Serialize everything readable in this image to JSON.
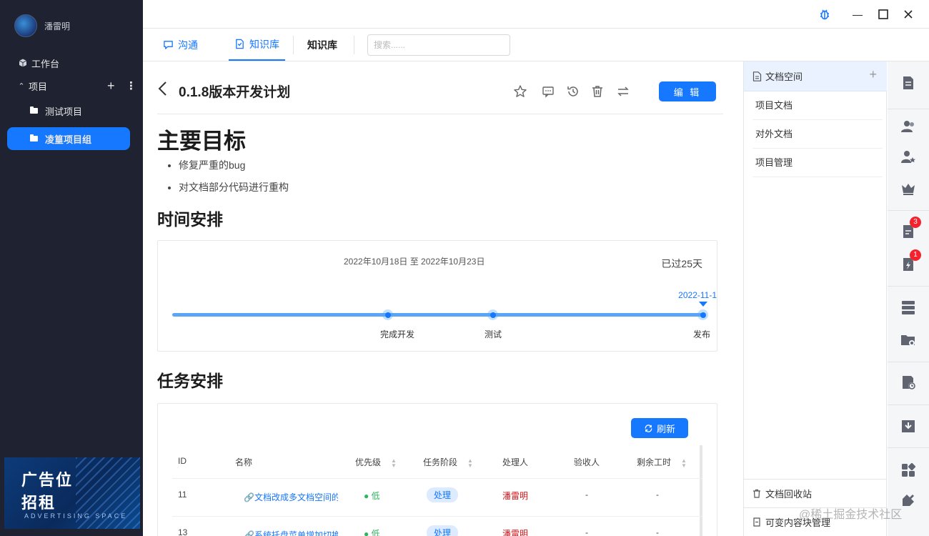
{
  "user": {
    "name": "潘雷明"
  },
  "sidebar": {
    "items": [
      {
        "label": "工作台"
      },
      {
        "label": "项目"
      },
      {
        "label": "测试项目"
      },
      {
        "label": "凌篁项目组"
      }
    ],
    "ad": {
      "line1": "广告位",
      "line2": "招租",
      "line3": "ADVERTISING SPACE"
    }
  },
  "tabs": [
    {
      "label": "沟通"
    },
    {
      "label": "知识库"
    },
    {
      "label": "知识库"
    }
  ],
  "search": {
    "placeholder": "搜索......"
  },
  "doc": {
    "title": "0.1.8版本开发计划",
    "edit_label": "编 辑",
    "heading_goals": "主要目标",
    "goals": [
      "修复严重的bug",
      "对文档部分代码进行重构"
    ],
    "heading_schedule": "时间安排",
    "heading_tasks": "任务安排"
  },
  "timeline": {
    "range": "2022年10月18日 至 2022年10月23日",
    "elapsed": "已过25天",
    "marker_date": "2022-11-1",
    "milestones": [
      "完成开发",
      "测试",
      "发布"
    ]
  },
  "tasks": {
    "refresh_label": "刷新",
    "columns": [
      "ID",
      "名称",
      "优先级",
      "任务阶段",
      "处理人",
      "验收人",
      "剩余工时"
    ],
    "rows": [
      {
        "id": "11",
        "name": "🔗文档改成多文档空间的",
        "priority": "● 低",
        "stage": "处理",
        "handler": "潘雷明",
        "reviewer": "-",
        "remaining": "-"
      },
      {
        "id": "13",
        "name": "🔗系统托盘菜单增加切换",
        "priority": "● 低",
        "stage": "处理",
        "handler": "潘雷明",
        "reviewer": "-",
        "remaining": "-"
      }
    ]
  },
  "doc_space": {
    "title": "文档空间",
    "items": [
      "项目文档",
      "对外文档",
      "项目管理"
    ],
    "footer": [
      "文档回收站",
      "可变内容块管理"
    ]
  },
  "rail": {
    "badges": [
      "3",
      "1"
    ]
  },
  "watermark": "@稀土掘金技术社区",
  "colors": {
    "accent": "#1677ff",
    "sidebar_bg": "#1f2230",
    "danger": "#f5222d",
    "success": "#2db55d"
  }
}
